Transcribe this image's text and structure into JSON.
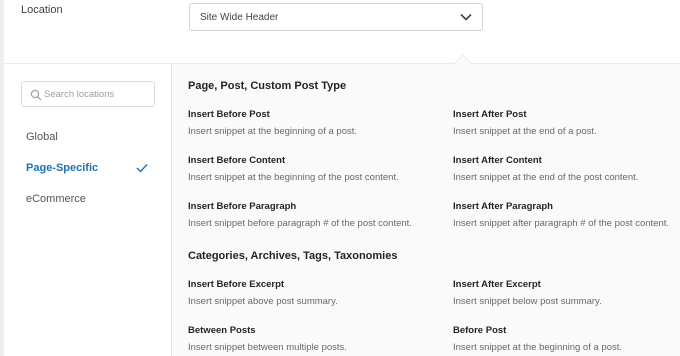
{
  "location": {
    "label": "Location",
    "selected": "Site Wide Header"
  },
  "search": {
    "placeholder": "Search locations"
  },
  "sidebar": {
    "items": [
      {
        "label": "Global",
        "active": false
      },
      {
        "label": "Page-Specific",
        "active": true
      },
      {
        "label": "eCommerce",
        "active": false
      }
    ]
  },
  "sections": [
    {
      "title": "Page, Post, Custom Post Type",
      "options": [
        {
          "title": "Insert Before Post",
          "desc": "Insert snippet at the beginning of a post."
        },
        {
          "title": "Insert After Post",
          "desc": "Insert snippet at the end of a post."
        },
        {
          "title": "Insert Before Content",
          "desc": "Insert snippet at the beginning of the post content."
        },
        {
          "title": "Insert After Content",
          "desc": "Insert snippet at the end of the post content."
        },
        {
          "title": "Insert Before Paragraph",
          "desc": "Insert snippet before paragraph # of the post content."
        },
        {
          "title": "Insert After Paragraph",
          "desc": "Insert snippet after paragraph # of the post content."
        }
      ]
    },
    {
      "title": "Categories, Archives, Tags, Taxonomies",
      "options": [
        {
          "title": "Insert Before Excerpt",
          "desc": "Insert snippet above post summary."
        },
        {
          "title": "Insert After Excerpt",
          "desc": "Insert snippet below post summary."
        },
        {
          "title": "Between Posts",
          "desc": "Insert snippet between multiple posts."
        },
        {
          "title": "Before Post",
          "desc": "Insert snippet at the beginning of a post."
        }
      ]
    }
  ],
  "colors": {
    "accent": "#2271b1"
  },
  "icons": {
    "dropdown": "chevron-down-icon",
    "search": "search-icon",
    "check": "check-icon"
  }
}
